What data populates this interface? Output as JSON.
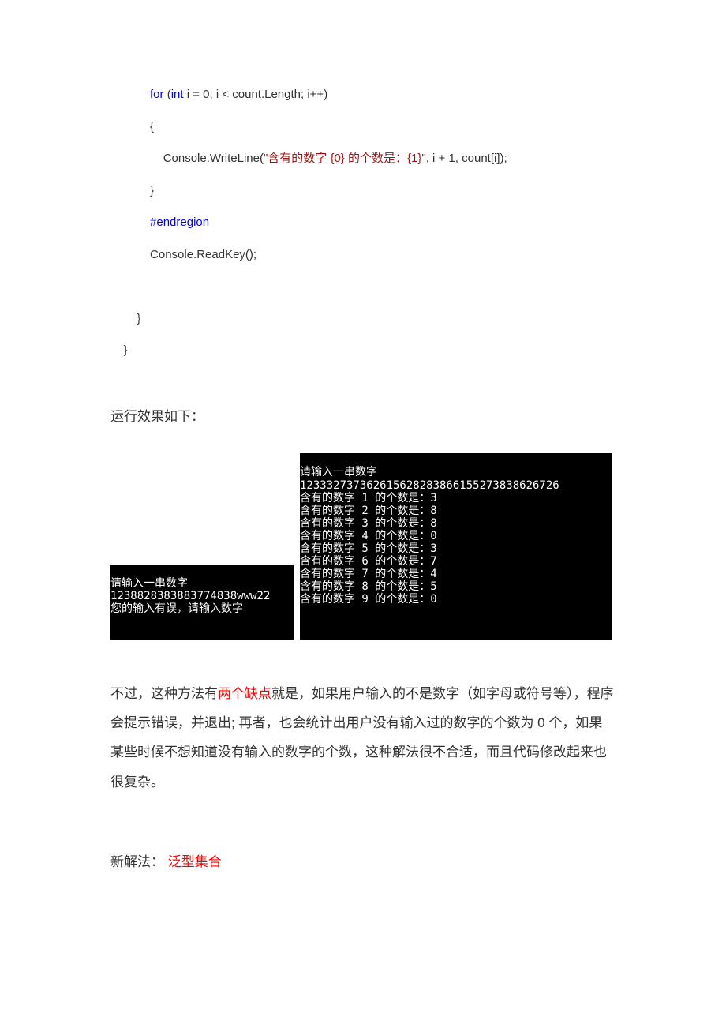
{
  "code": {
    "indent3": "            ",
    "indent4": "                ",
    "indent2": "        ",
    "indent1": "    ",
    "for_kw": "for",
    "open_paren": " (",
    "int_kw": "int",
    "i_eq": " i = ",
    "zero": "0",
    "for_rest": "; i < count.Length; i++)",
    "brace_open": "{",
    "console_write": "Console.WriteLine(",
    "str_literal": "\"含有的数字 {0} 的个数是：{1}\"",
    "after_str": ", i + ",
    "one": "1",
    "after_one": ", count[i]);",
    "brace_close": "}",
    "endregion": "#endregion",
    "readkey": "Console.ReadKey();",
    "end_brace1": "}",
    "end_brace2": "}"
  },
  "run_label": "运行效果如下：",
  "console_left": {
    "line1": "请输入一串数字",
    "line2": "1238828383883774838www22",
    "line3": "您的输入有误，请输入数字"
  },
  "console_right": {
    "line0": "请输入一串数字",
    "line1": "123332737362615628283866155273838626726",
    "rows": [
      "含有的数字 1 的个数是：3",
      "含有的数字 2 的个数是：8",
      "含有的数字 3 的个数是：8",
      "含有的数字 4 的个数是：0",
      "含有的数字 5 的个数是：3",
      "含有的数字 6 的个数是：7",
      "含有的数字 7 的个数是：4",
      "含有的数字 8 的个数是：5",
      "含有的数字 9 的个数是：0"
    ]
  },
  "analysis": {
    "pre": "不过，这种方法有",
    "flaw": "两个缺点",
    "rest": "就是，如果用户输入的不是数字（如字母或符号等），程序会提示错误，并退出; 再者，也会统计出用户没有输入过的数字的个数为 0 个，如果某些时候不想知道没有输入的数字的个数，这种解法很不合适，而且代码修改起来也很复杂。"
  },
  "new_method": {
    "label": "新解法：",
    "spacing": "    ",
    "name": "泛型集合"
  }
}
